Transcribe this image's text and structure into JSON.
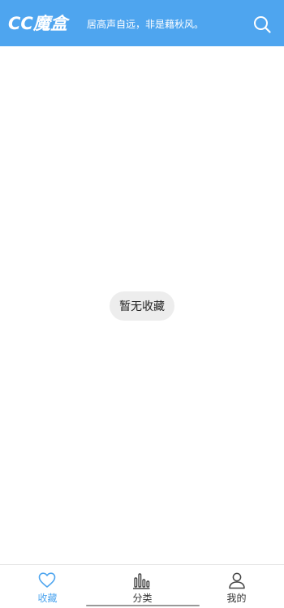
{
  "header": {
    "logo_text": "CC魔盒",
    "slogan": "居高声自远，非是藉秋风。",
    "background_color": "#4ea5ef",
    "search_icon": "search-icon"
  },
  "main": {
    "empty_message": "暂无收藏"
  },
  "tabbar": {
    "active_color": "#4ea5ef",
    "tabs": [
      {
        "label": "收藏",
        "icon": "heart-icon",
        "active": true
      },
      {
        "label": "分类",
        "icon": "bar-chart-icon",
        "active": false
      },
      {
        "label": "我的",
        "icon": "user-icon",
        "active": false
      }
    ]
  }
}
